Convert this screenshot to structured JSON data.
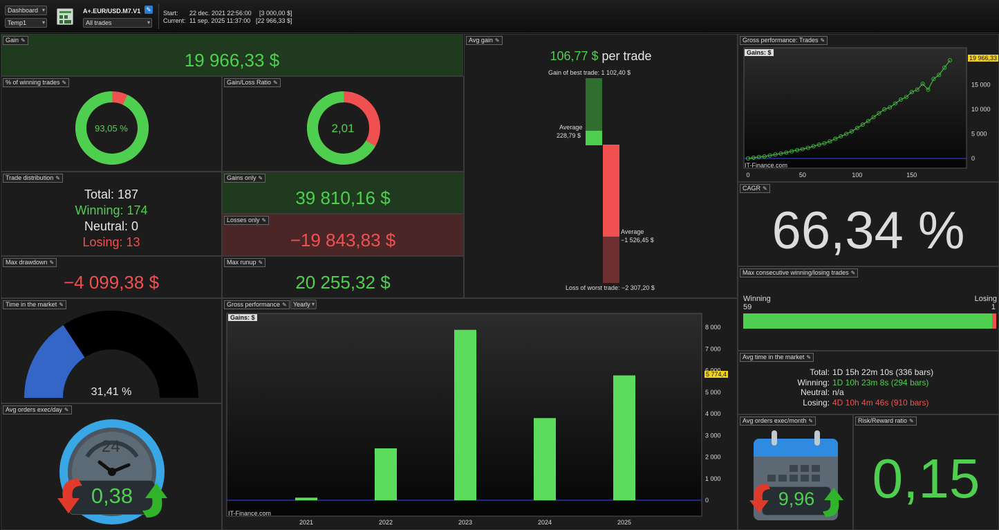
{
  "toolbar": {
    "dashboard_select": "Dashboard",
    "template_select": "Temp1",
    "strategy_name": "A+.EUR/USD.M7.V1",
    "trades_filter": "All trades",
    "start_label": "Start:",
    "start_date": "22 dec. 2021 22:56:00",
    "start_value": "[3 000,00 $]",
    "current_label": "Current:",
    "current_date": "11 sep. 2025 11:37:00",
    "current_value": "[22 966,33 $]",
    "icons": [
      "grid-chart-icon",
      "edit-icon"
    ]
  },
  "gain": {
    "title": "Gain",
    "value": "19 966,33 $"
  },
  "winning_pct": {
    "title": "% of winning trades",
    "label": "93,05 %",
    "fraction": 0.9305
  },
  "gain_loss_ratio": {
    "title": "Gain/Loss Ratio",
    "label": "2,01",
    "fraction": 0.668
  },
  "trade_distribution": {
    "title": "Trade distribution",
    "total": "Total: 187",
    "winning": "Winning: 174",
    "neutral": "Neutral: 0",
    "losing": "Losing: 13"
  },
  "gains_only": {
    "title": "Gains only",
    "value": "39 810,16 $"
  },
  "losses_only": {
    "title": "Losses only",
    "value": "−19 843,83 $"
  },
  "max_drawdown": {
    "title": "Max drawdown",
    "value": "−4 099,38 $"
  },
  "max_runup": {
    "title": "Max runup",
    "value": "20 255,32 $"
  },
  "avg_gain": {
    "title": "Avg gain",
    "value": "106,77 $",
    "suffix": " per trade",
    "best_trade": "Gain of best trade: 1 102,40 $",
    "avg_win_label": "Average",
    "avg_win_value": "228,79 $",
    "avg_loss_label": "Average",
    "avg_loss_value": "−1 526,45 $",
    "worst_trade": "Loss of worst trade: −2 307,20 $"
  },
  "time_in_market": {
    "title": "Time in the market",
    "label": "31,41 %",
    "fraction": 0.3141
  },
  "avg_orders_day": {
    "title": "Avg orders exec/day",
    "value": "0,38",
    "clock_label": "24"
  },
  "gross_performance": {
    "title": "Gross performance",
    "period": "Yearly",
    "legend": "Gains: $",
    "watermark": "IT-Finance.com",
    "current_marker": "5 774,4"
  },
  "gross_trades": {
    "title": "Gross performance: Trades",
    "legend": "Gains: $",
    "watermark": "IT-Finance.com",
    "last_value": "19 966,33"
  },
  "cagr": {
    "title": "CAGR",
    "value": "66,34 %"
  },
  "max_consecutive": {
    "title": "Max consecutive winning/losing trades",
    "winning_label": "Winning",
    "winning_value": "59",
    "losing_label": "Losing",
    "losing_value": "1",
    "winning_fraction": 0.983
  },
  "avg_time": {
    "title": "Avg time in the market",
    "rows": [
      {
        "label": "Total:",
        "value": "1D 15h 22m 10s (336 bars)",
        "color": "#e6e6e6"
      },
      {
        "label": "Winning:",
        "value": "1D 10h 23m 8s (294 bars)",
        "color": "#4fcf4f"
      },
      {
        "label": "Neutral:",
        "value": "n/a",
        "color": "#e6e6e6"
      },
      {
        "label": "Losing:",
        "value": "4D 10h 4m 46s (910 bars)",
        "color": "#f05050"
      }
    ]
  },
  "avg_orders_month": {
    "title": "Avg orders exec/month",
    "value": "9,96"
  },
  "risk_reward": {
    "title": "Risk/Reward ratio",
    "value": "0,15"
  },
  "chart_data": [
    {
      "type": "bar",
      "legend": "Gains: $",
      "categories": [
        "2021",
        "2022",
        "2023",
        "2024",
        "2025"
      ],
      "values": [
        120,
        2400,
        7880,
        3800,
        5774.4
      ],
      "yticks": [
        "8 000",
        "7 000",
        "6 000",
        "5 000",
        "4 000",
        "3 000",
        "2 000",
        "1 000",
        "0"
      ],
      "ylim": [
        0,
        8500
      ],
      "color": "#5cdc5c"
    },
    {
      "type": "line",
      "legend": "Gains: $",
      "x": [
        0,
        5,
        10,
        15,
        20,
        25,
        30,
        35,
        40,
        45,
        50,
        55,
        60,
        65,
        70,
        75,
        80,
        85,
        90,
        95,
        100,
        105,
        110,
        115,
        120,
        125,
        130,
        135,
        140,
        145,
        150,
        155,
        160,
        165,
        170,
        175,
        180,
        185
      ],
      "y": [
        0,
        150,
        300,
        400,
        600,
        800,
        1000,
        1200,
        1450,
        1700,
        1900,
        2150,
        2500,
        2800,
        3100,
        3500,
        4000,
        4500,
        5000,
        5500,
        6200,
        6900,
        7600,
        8400,
        9200,
        10000,
        10400,
        11200,
        12000,
        12500,
        13500,
        14000,
        15200,
        14000,
        16200,
        17000,
        18500,
        19966.33
      ],
      "xticks": [
        "0",
        "50",
        "100",
        "150"
      ],
      "yticks": [
        "15 000",
        "10 000",
        "5 000",
        "0"
      ],
      "xlim": [
        0,
        197
      ],
      "ylim": [
        -400,
        20500
      ],
      "color": "#3cbc3c"
    }
  ]
}
